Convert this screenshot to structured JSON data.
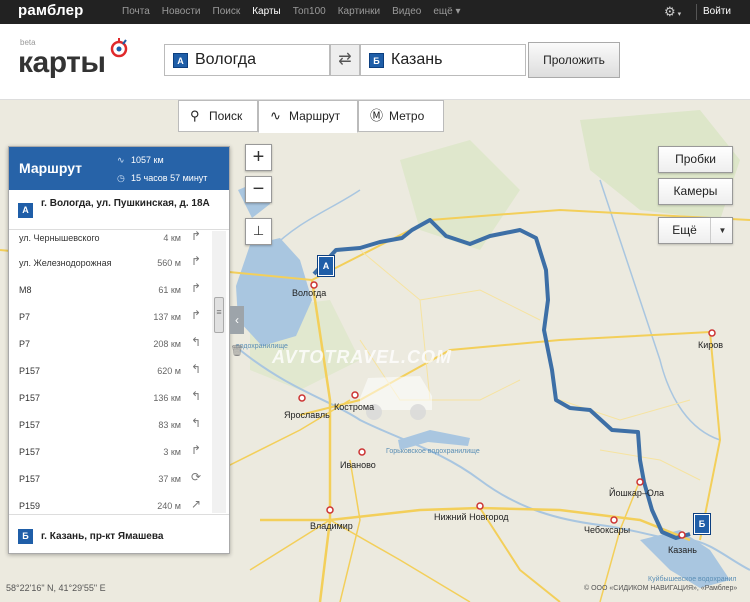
{
  "topbar": {
    "logo": "рамблер",
    "nav": [
      "Почта",
      "Новости",
      "Поиск",
      "Карты",
      "Топ100",
      "Картинки",
      "Видео",
      "ещё ▾"
    ],
    "active_nav": "Карты",
    "settings_icon": "gear-icon",
    "exit": "Войти"
  },
  "header": {
    "brand_beta": "beta",
    "brand": "карты",
    "from_label": "А",
    "from_value": "Вологда",
    "to_label": "Б",
    "to_value": "Казань",
    "swap": "⇄",
    "route_button": "Проложить"
  },
  "tabs": {
    "search": "Поиск",
    "route": "Маршрут",
    "metro": "Метро"
  },
  "panel": {
    "title": "Маршрут",
    "distance": "1057 км",
    "duration": "15 часов 57 минут",
    "start_label": "А",
    "start_address": "г. Вологда, ул. Пушкинская, д. 18А",
    "end_label": "Б",
    "end_address": "г. Казань, пр-кт Ямашева",
    "steps": [
      {
        "name": "ул. Чернышевского",
        "dist": "4 км",
        "arrow": "↱"
      },
      {
        "name": "ул. Железнодорожная",
        "dist": "560 м",
        "arrow": "↱"
      },
      {
        "name": "М8",
        "dist": "61 км",
        "arrow": "↱"
      },
      {
        "name": "Р7",
        "dist": "137 км",
        "arrow": "↱"
      },
      {
        "name": "Р7",
        "dist": "208 км",
        "arrow": "↰"
      },
      {
        "name": "Р157",
        "dist": "620 м",
        "arrow": "↰"
      },
      {
        "name": "Р157",
        "dist": "136 км",
        "arrow": "↰"
      },
      {
        "name": "Р157",
        "dist": "83 км",
        "arrow": "↰"
      },
      {
        "name": "Р157",
        "dist": "3 км",
        "arrow": "↱"
      },
      {
        "name": "Р157",
        "dist": "37 км",
        "arrow": "⟳"
      },
      {
        "name": "Р159",
        "dist": "240 м",
        "arrow": "↗"
      }
    ]
  },
  "controls": {
    "zoom_in": "+",
    "zoom_out": "−",
    "ruler": "⊥",
    "traffic": "Пробки",
    "cameras": "Камеры",
    "more": "Ещё",
    "more_arrow": "▼"
  },
  "map": {
    "cities": {
      "vologda": "Вологда",
      "kirov": "Киров",
      "yaroslavl": "Ярославль",
      "kostroma": "Кострома",
      "ivanovo": "Иваново",
      "yoshkar_ola": "Йошкар–Ола",
      "cheboksary": "Чебоксары",
      "vladimir": "Владимир",
      "nizhny": "Нижний Новгород",
      "kazan": "Казань"
    },
    "water": {
      "rybinsk": "водохранилище",
      "gorky": "Горьковское водохранилище",
      "kuibyshev": "Куйбышевское водохранил"
    },
    "pin_a": "А",
    "pin_b": "Б",
    "watermark": "AVTOTRAVEL.COM",
    "coords": "58°22'16\" N, 41°29'55\" E",
    "copyright": "© ООО «СИДИКОМ НАВИГАЦИЯ», «Рамблер»"
  },
  "colors": {
    "route": "#3d6fa6",
    "accent": "#2763a8",
    "topbar": "#222222",
    "water": "#a9c6e0",
    "road": "#f3cf5a"
  }
}
